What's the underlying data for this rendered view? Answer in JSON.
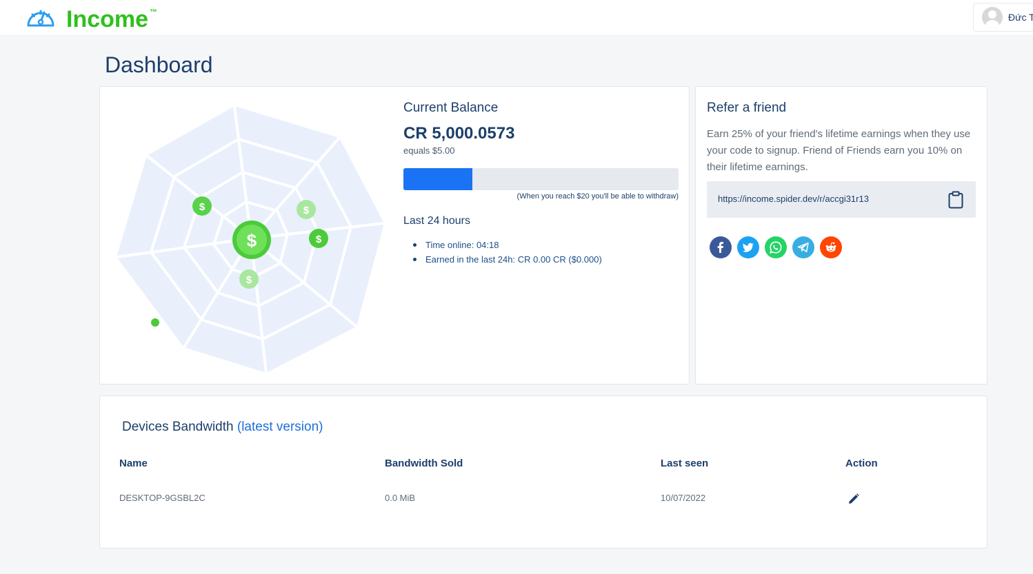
{
  "brand": {
    "name": "Income",
    "tm": "™",
    "color": "#2ec01c",
    "icon": "speedometer-icon"
  },
  "user": {
    "name": "Đức T",
    "avatar": "default-avatar-icon"
  },
  "page": {
    "title": "Dashboard"
  },
  "balance": {
    "title": "Current Balance",
    "value": "CR 5,000.0573",
    "equals": "equals $5.00",
    "progress_fraction": 0.25,
    "progress_color": "#1a73f5",
    "withdraw_note": "(When you reach $20 you'll be able to withdraw)",
    "last24_title": "Last 24 hours",
    "last24_items": [
      "Time online: 04:18",
      "Earned in the last 24h: CR 0.00 CR ($0.000)"
    ]
  },
  "refer": {
    "title": "Refer a friend",
    "text": "Earn 25% of your friend's lifetime earnings when they use your code to signup.  Friend of Friends earn you 10% on their lifetime earnings.",
    "link": "https://income.spider.dev/r/accgi31r13",
    "copy_icon": "clipboard-icon",
    "share": [
      {
        "name": "facebook",
        "color": "#3b5998"
      },
      {
        "name": "twitter",
        "color": "#1da1f2"
      },
      {
        "name": "whatsapp",
        "color": "#25d366"
      },
      {
        "name": "telegram",
        "color": "#37aee2"
      },
      {
        "name": "reddit",
        "color": "#ff4500"
      }
    ]
  },
  "devices": {
    "title": "Devices Bandwidth",
    "latest_link": "(latest version)",
    "columns": [
      "Name",
      "Bandwidth Sold",
      "Last seen",
      "Action"
    ],
    "rows": [
      {
        "name": "DESKTOP-9GSBL2C",
        "bandwidth": "0.0 MiB",
        "last_seen": "10/07/2022",
        "action_icon": "pencil-icon"
      }
    ]
  }
}
